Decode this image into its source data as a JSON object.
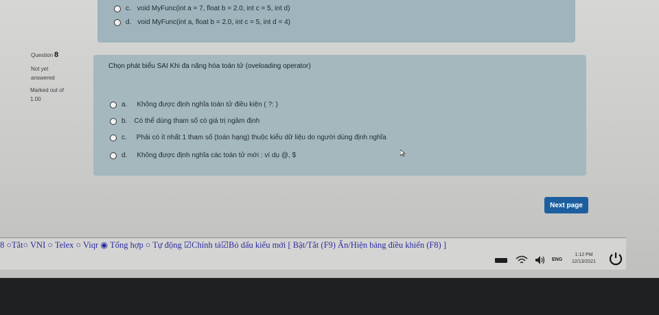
{
  "previous_question": {
    "options": [
      {
        "letter": "c.",
        "text": "void MyFunc(int a = 7, float b = 2.0, int c = 5, int d)"
      },
      {
        "letter": "d.",
        "text": "void MyFunc(int a, float b = 2.0, int c = 5, int d = 4)"
      }
    ]
  },
  "question": {
    "label": "Question",
    "number": "8",
    "status": [
      "Not yet",
      "answered"
    ],
    "marked": [
      "Marked out of",
      "1.00"
    ],
    "text": "Chọn phát biểu SAI  Khi  đa năng hóa toán tử (oveloading operator)",
    "options": [
      {
        "letter": "a.",
        "text": "Không được định nghĩa toán tử điều kiện ( ?: )"
      },
      {
        "letter": "b.",
        "text": "Có thể dùng tham số có giá trị ngầm định"
      },
      {
        "letter": "c.",
        "text": "Phải có ít nhất 1 tham số (toán hạng) thuộc kiểu dữ liệu do người dùng định nghĩa"
      },
      {
        "letter": "d.",
        "text": "Không được định nghĩa các toán tử mới : ví dụ @, $"
      }
    ]
  },
  "next_button": "Next page",
  "ime_bar": "8 ○Tắt○ VNI ○ Telex ○ Viqr ◉ Tổng hợp ○ Tự động ☑Chính tả☑Bỏ dấu kiểu mới [ Bật/Tắt (F9) Ẩn/Hiện bảng điều khiển (F8) ]",
  "tray": {
    "lang": "ENG",
    "time": "1:12 PM",
    "date": "12/13/2021"
  }
}
